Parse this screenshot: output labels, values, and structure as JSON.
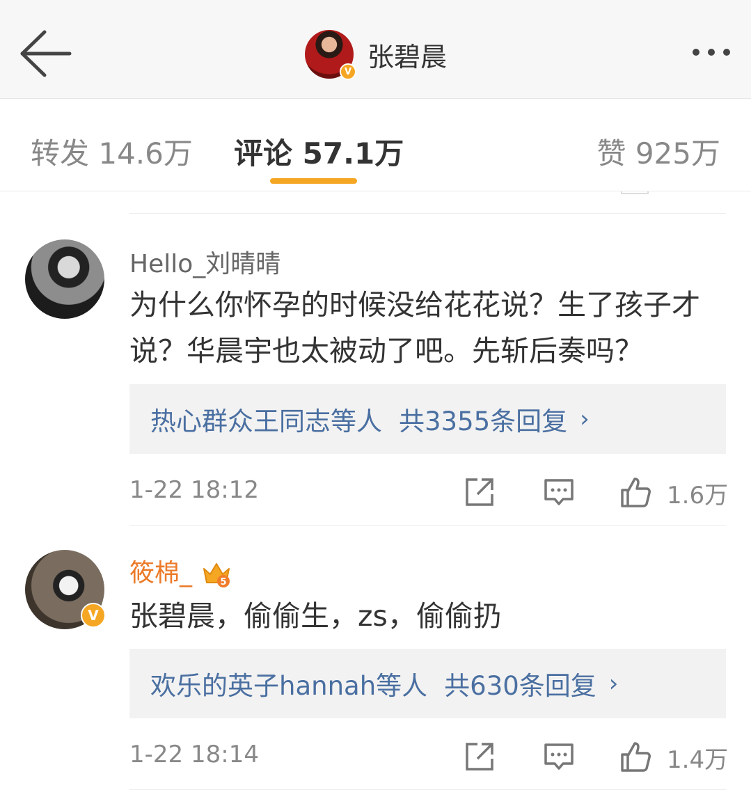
{
  "header": {
    "title": "张碧晨",
    "verified_badge": "V",
    "back_icon": "back-arrow-icon",
    "more_icon": "more-dots-icon"
  },
  "tabs": [
    {
      "label": "转发 14.6万",
      "active": false
    },
    {
      "label": "评论 57.1万",
      "active": true
    },
    {
      "label": "赞 925万",
      "active": false
    }
  ],
  "colors": {
    "accent": "#f5a623",
    "link": "#4a6fa1",
    "vip_name": "#ec7a28"
  },
  "comments": [
    {
      "username": "Hello_刘晴晴",
      "text": "为什么你怀孕的时候没给花花说？生了孩子才说？华晨宇也太被动了吧。先斩后奏吗？",
      "replies_users": "热心群众王同志等人",
      "replies_count": "共3355条回复",
      "replies_chevron": "›",
      "time": "1-22 18:12",
      "likes": "1.6万"
    },
    {
      "username": "筱棉_",
      "vip_level": "5",
      "verified_badge": "V",
      "text": "张碧晨，偷偷生，zs，偷偷扔",
      "replies_users": "欢乐的英子hannah等人",
      "replies_count": "共630条回复",
      "replies_chevron": "›",
      "time": "1-22 18:14",
      "likes": "1.4万"
    }
  ]
}
